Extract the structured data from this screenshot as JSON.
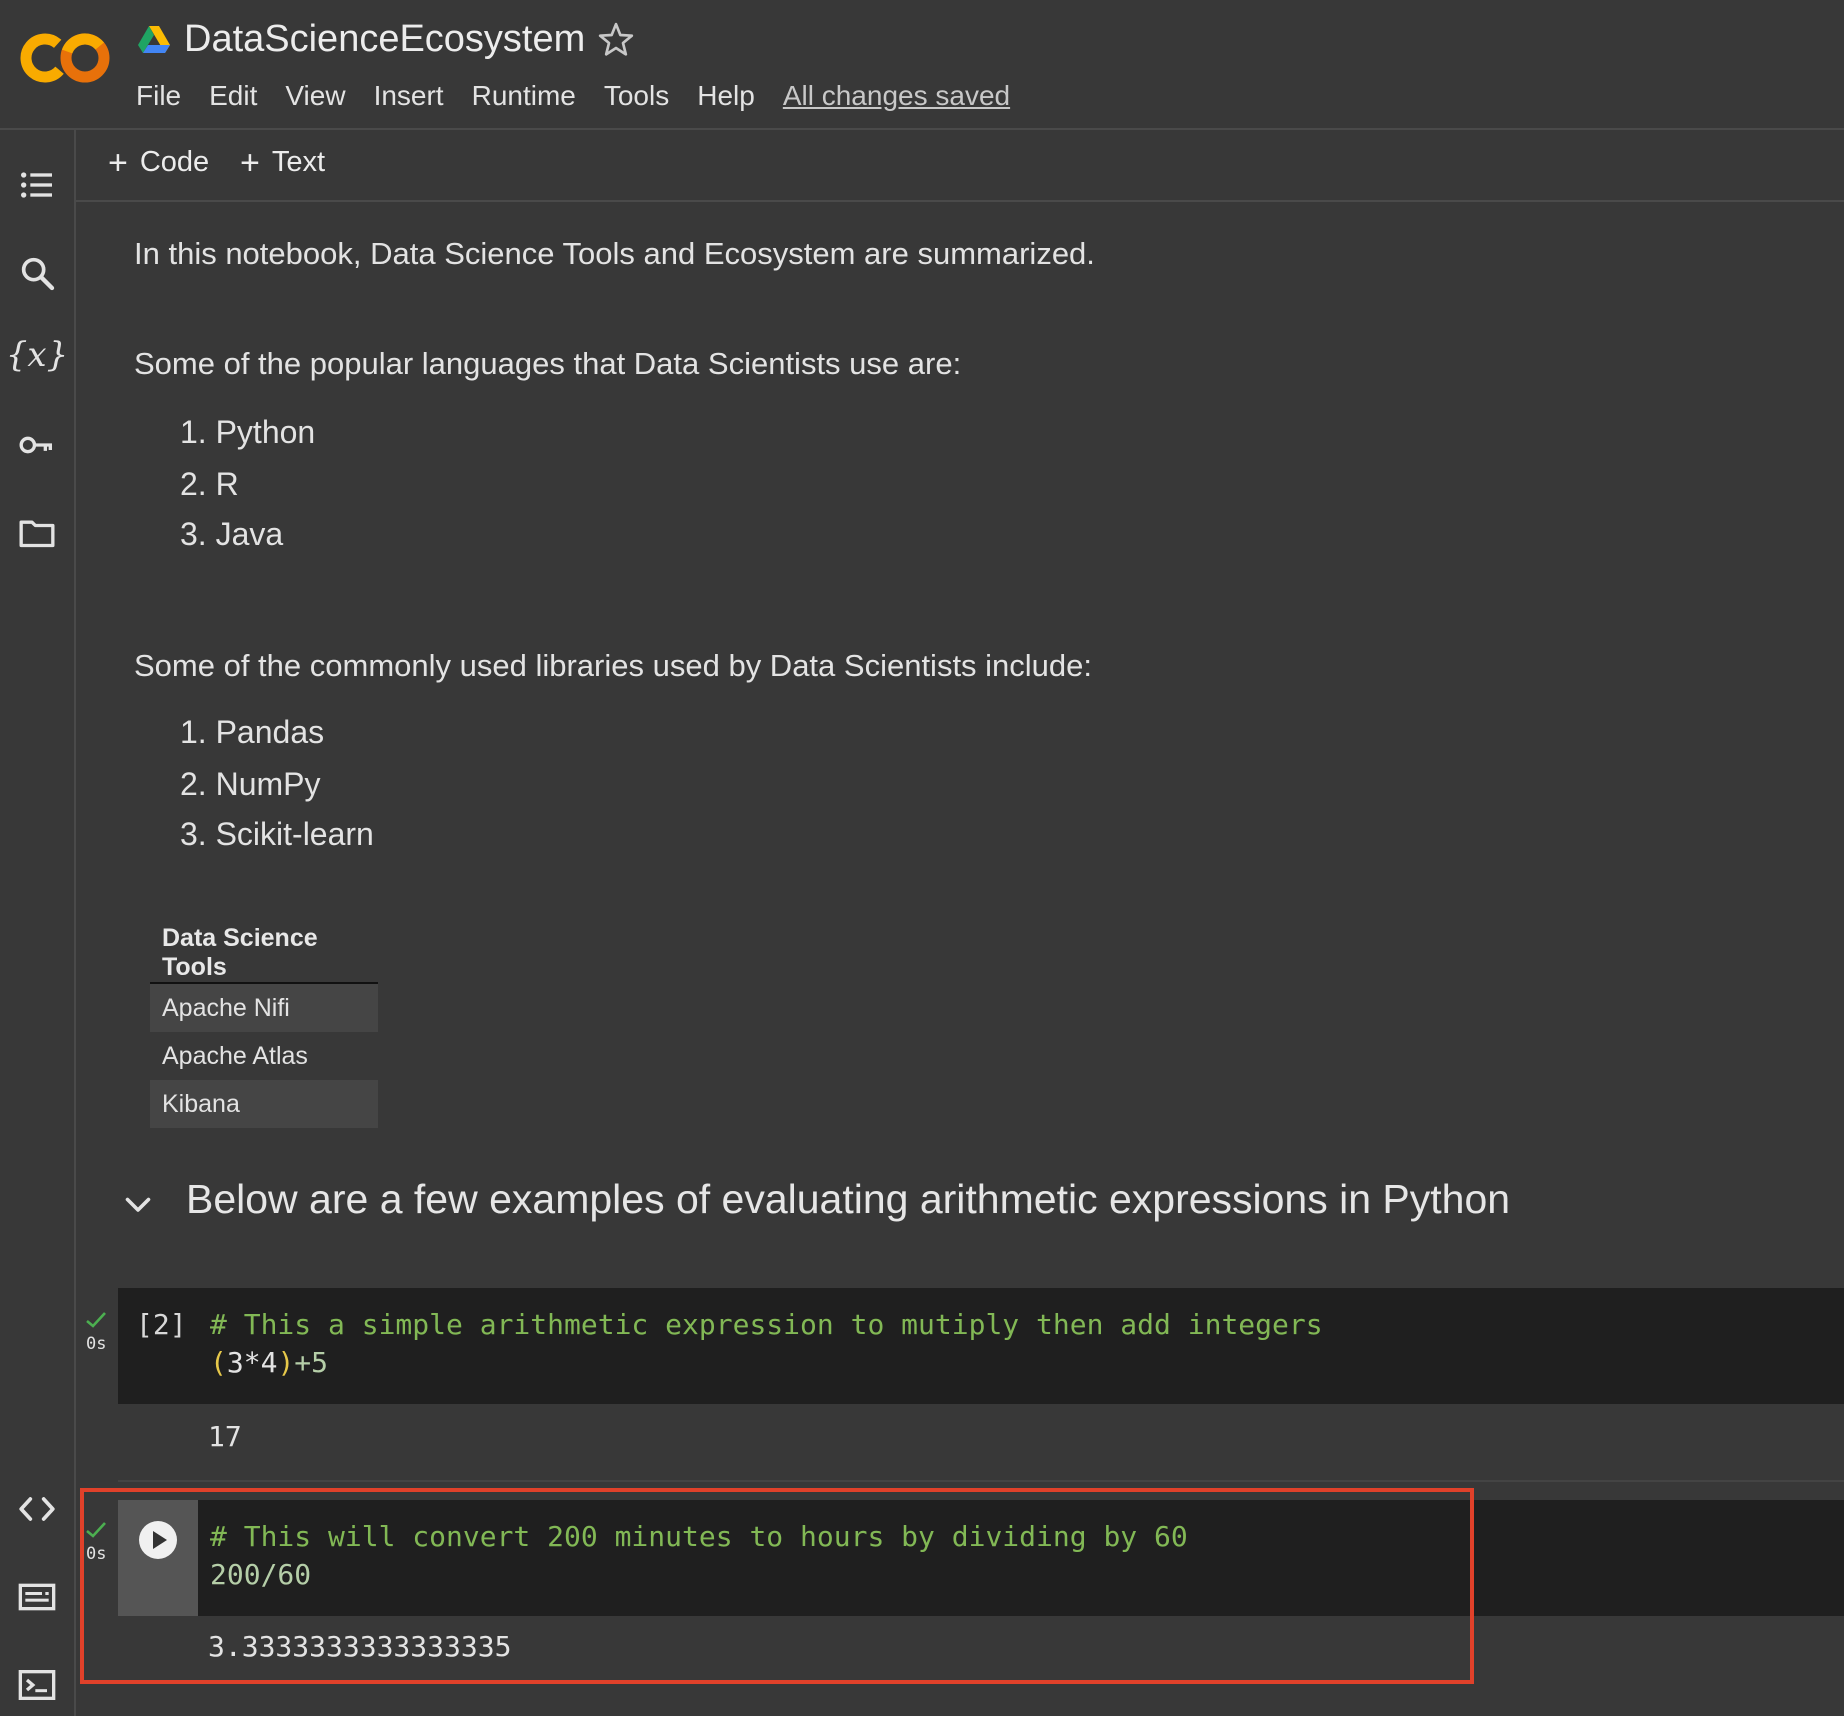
{
  "header": {
    "title": "DataScienceEcosystem",
    "menu": [
      "File",
      "Edit",
      "View",
      "Insert",
      "Runtime",
      "Tools",
      "Help"
    ],
    "save_status": "All changes saved"
  },
  "toolbar": {
    "code_label": "Code",
    "text_label": "Text"
  },
  "sidebar_icons": [
    "table-of-contents-icon",
    "search-icon",
    "variables-icon",
    "secrets-key-icon",
    "files-folder-icon",
    "code-snippets-icon",
    "command-palette-icon",
    "terminal-icon"
  ],
  "variables_glyph": "{x}",
  "notebook": {
    "intro": "In this notebook, Data Science Tools and Ecosystem are summarized.",
    "languages_heading": "Some of the popular languages that Data Scientists use are:",
    "languages": [
      "1. Python",
      "2. R",
      "3. Java"
    ],
    "libraries_heading": "Some of the commonly used libraries used by Data Scientists include:",
    "libraries": [
      "1. Pandas",
      "2. NumPy",
      "3. Scikit-learn"
    ],
    "tools_table": {
      "header": "Data Science Tools",
      "rows": [
        "Apache Nifi",
        "Apache Atlas",
        "Kibana"
      ]
    },
    "section_heading": "Below are a few examples of evaluating arithmetic expressions in Python",
    "cells": [
      {
        "exec_count": "[2]",
        "duration": "0s",
        "comment": "# This a simple arithmetic expression to mutiply then add integers",
        "code": {
          "open": "(",
          "expr": "3*4",
          "close": ")",
          "tail": "+5"
        },
        "output": "17"
      },
      {
        "duration": "0s",
        "comment": "# This will convert 200 minutes to hours by dividing by 60",
        "code": "200/60",
        "output": "3.3333333333333335"
      }
    ]
  },
  "colors": {
    "background": "#383838",
    "code_background": "#1f1f1f",
    "comment": "#82b855",
    "highlight_border": "#e0412a",
    "success_check": "#4caf50"
  }
}
